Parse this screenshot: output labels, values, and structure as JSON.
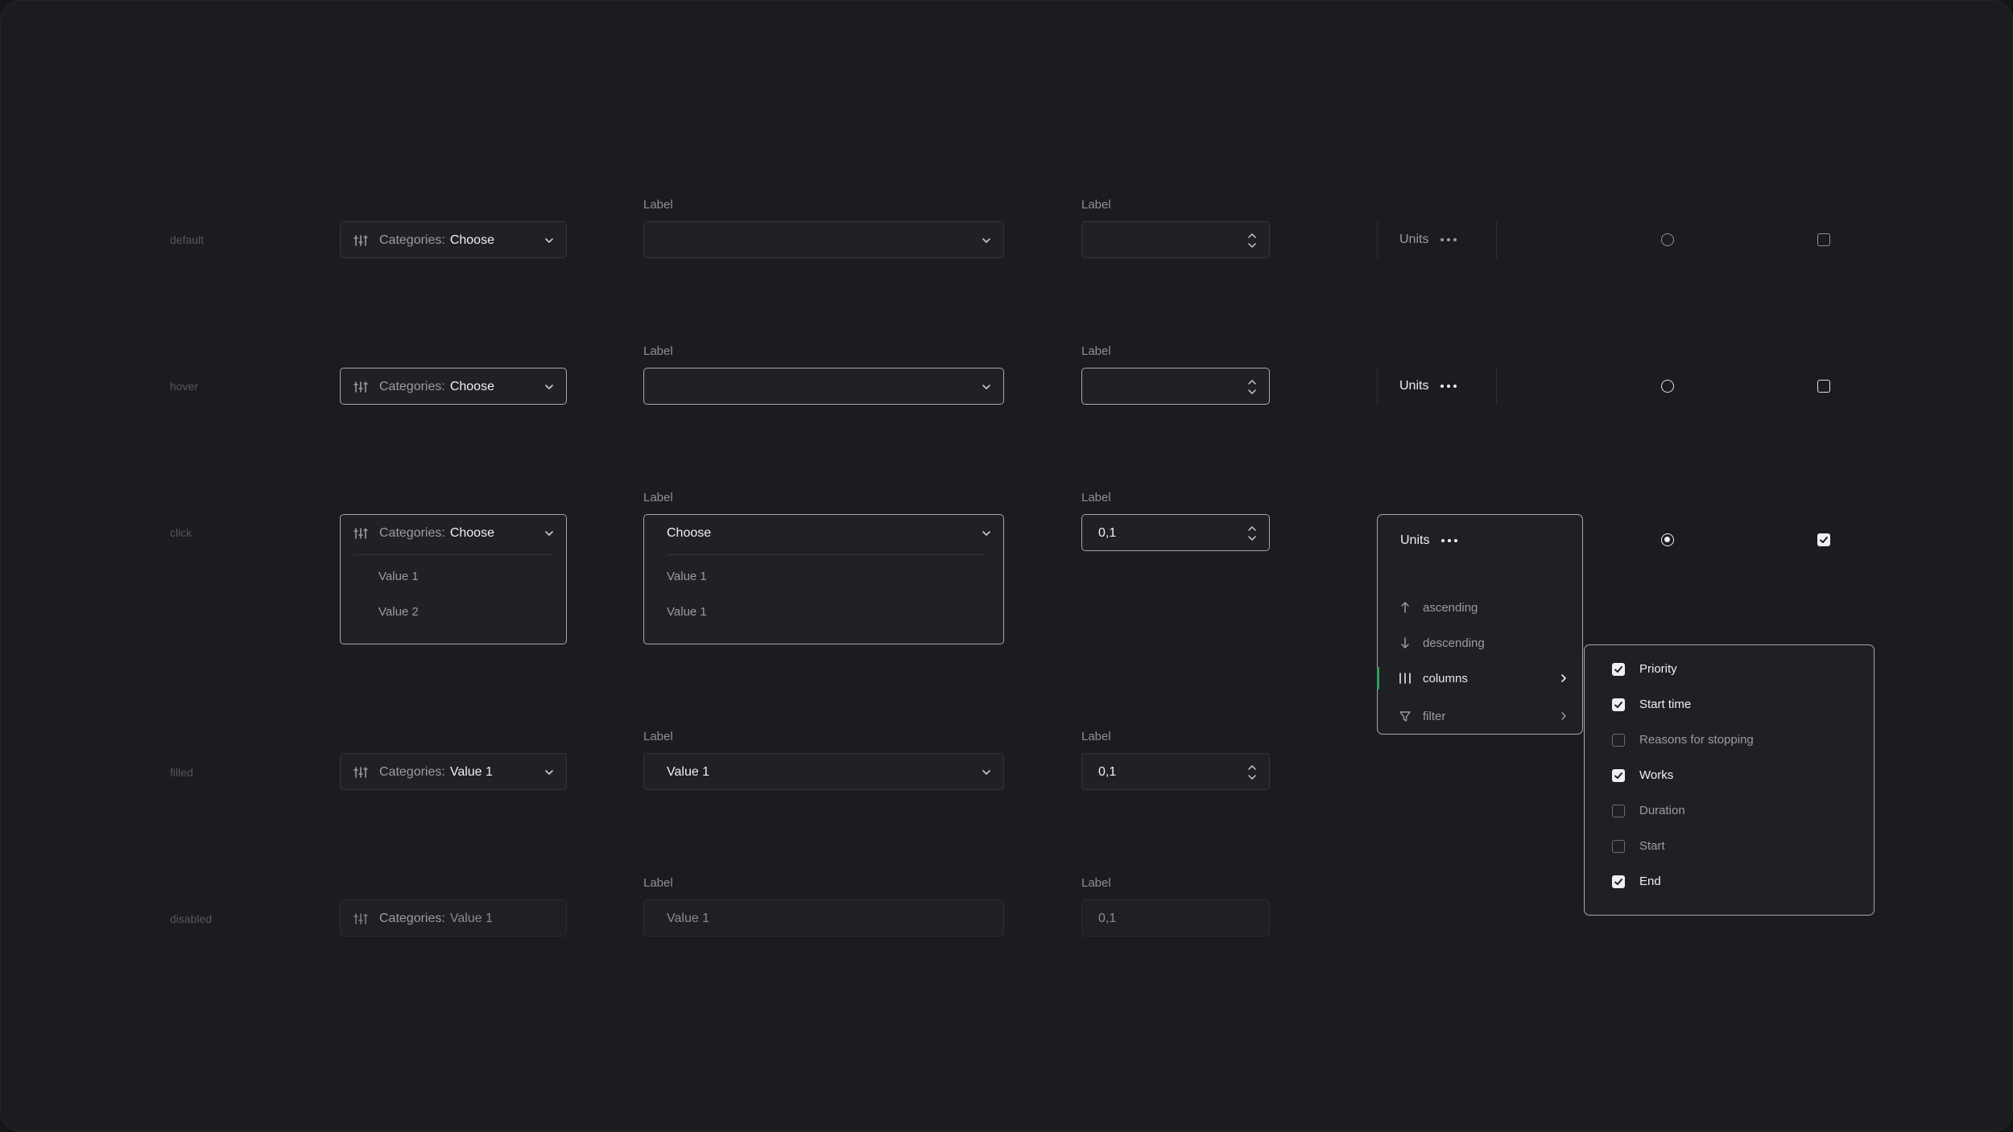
{
  "states": [
    "default",
    "hover",
    "click",
    "filled",
    "disabled"
  ],
  "category_select": {
    "prefix": "Categories:",
    "placeholder": "Choose",
    "filled_value": "Value 1",
    "options": [
      "Value 1",
      "Value 2"
    ]
  },
  "select_field": {
    "label": "Label",
    "placeholder": "Choose",
    "filled_value": "Value 1",
    "options": [
      "Value 1",
      "Value 1"
    ]
  },
  "number_field": {
    "label": "Label",
    "value": "0,1"
  },
  "units_menu": {
    "title": "Units",
    "items": [
      {
        "label": "ascending",
        "icon": "arrow-up-icon"
      },
      {
        "label": "descending",
        "icon": "arrow-down-icon"
      },
      {
        "label": "columns",
        "icon": "columns-icon"
      },
      {
        "label": "filter",
        "icon": "filter-icon"
      }
    ]
  },
  "columns_submenu": {
    "items": [
      {
        "label": "Priority",
        "checked": true
      },
      {
        "label": "Start time",
        "checked": true
      },
      {
        "label": "Reasons for stopping",
        "checked": false
      },
      {
        "label": "Works",
        "checked": true
      },
      {
        "label": "Duration",
        "checked": false
      },
      {
        "label": "Start",
        "checked": false
      },
      {
        "label": "End",
        "checked": true
      }
    ]
  },
  "colors": {
    "background": "#1b1c20",
    "field": "#202125",
    "border": "#34363c",
    "border_active": "#a5a7ac",
    "accent": "#2ea05a",
    "text": "#f0f0f2",
    "muted": "#9a9ca1"
  }
}
